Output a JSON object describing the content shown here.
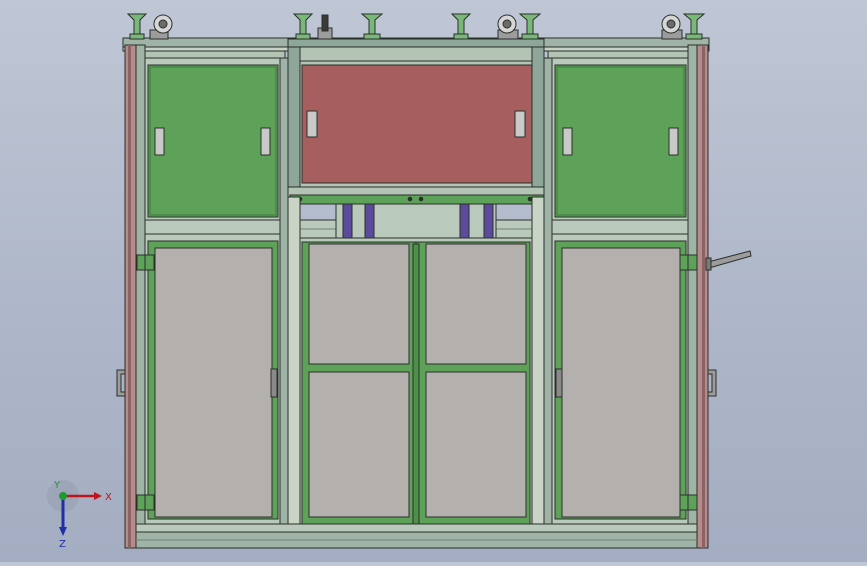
{
  "viewport": {
    "background_top": "#bfc6d5",
    "background_bottom": "#a4adc1"
  },
  "colors": {
    "frame_profile": "#8fa79a",
    "frame_profile_light": "#b9c9bb",
    "post_pink": "#b88a8a",
    "post_pink_dark": "#8a6464",
    "door_green": "#5ea25a",
    "door_green_dark": "#3f7a3c",
    "panel_red": "#a65e5e",
    "glass_gray": "#b4b0ae",
    "caster_green": "#79b879",
    "purple_cylinder": "#5c4a9c",
    "lavender_block": "#b39bc0",
    "handle_gray": "#9c9c9c",
    "outline": "#2a2f2a"
  },
  "triad": {
    "x_label": "X",
    "y_label": "Y",
    "z_label": "Z",
    "x_color": "#c0141c",
    "y_color": "#1f9a2f",
    "z_color": "#1f2fa8"
  },
  "icons": {
    "triad": "coordinate-triad-icon",
    "caster": "caster-wheel-icon",
    "foot": "leveling-foot-icon",
    "handle": "door-handle-icon",
    "hinge": "hinge-icon"
  }
}
